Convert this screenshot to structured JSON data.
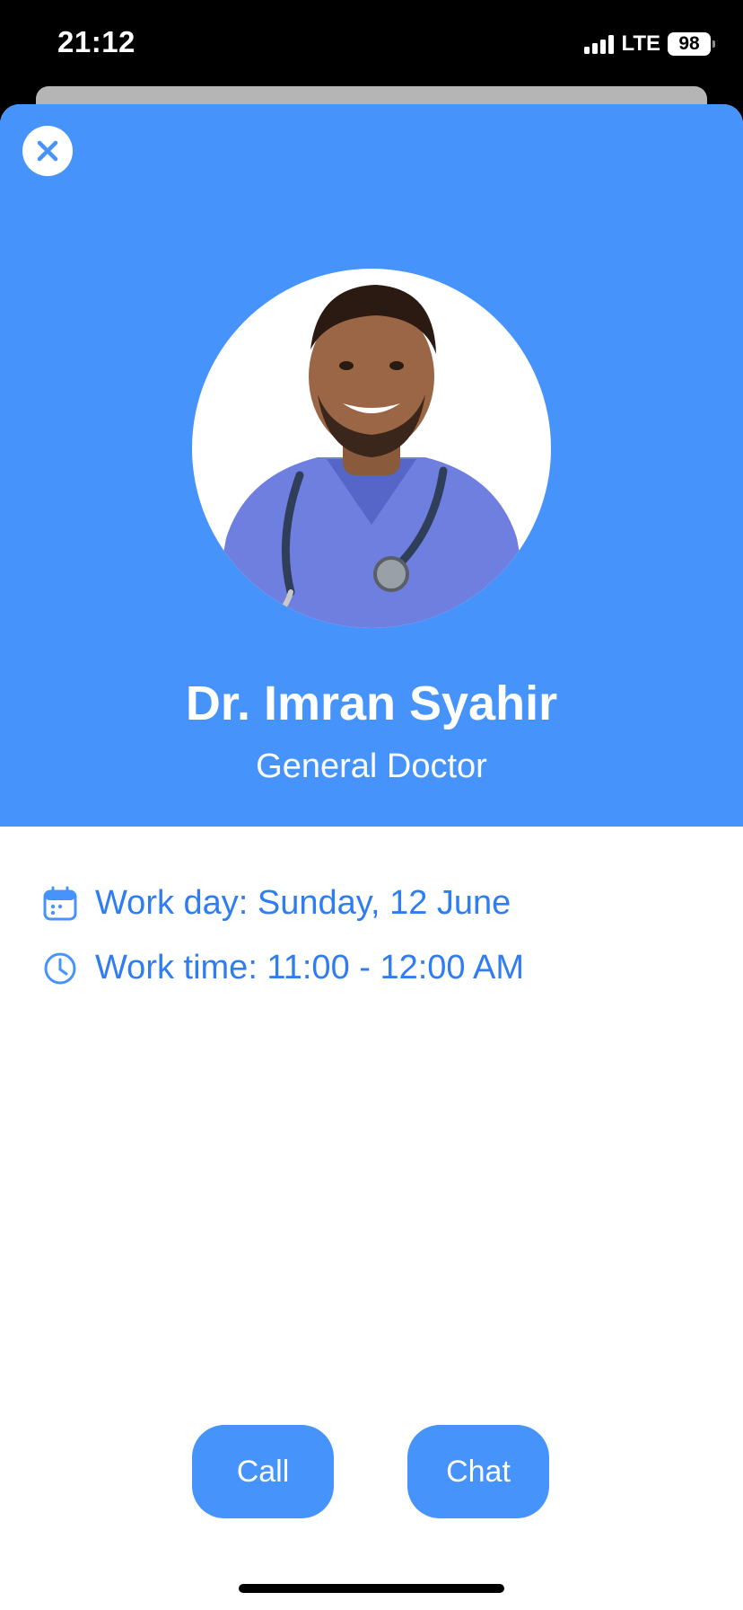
{
  "status_bar": {
    "time": "21:12",
    "network": "LTE",
    "battery": "98",
    "signal_bars": 4
  },
  "colors": {
    "accent": "#4694fb",
    "link_text": "#2f7df0"
  },
  "header": {
    "close_icon": "close-icon"
  },
  "doctor": {
    "name": "Dr. Imran Syahir",
    "role": "General Doctor",
    "avatar_icon": "doctor-photo"
  },
  "schedule": {
    "work_day": "Work day: Sunday, 12 June",
    "work_day_icon": "calendar-icon",
    "work_time": "Work time: 11:00 - 12:00 AM",
    "work_time_icon": "clock-icon"
  },
  "actions": {
    "call_label": "Call",
    "chat_label": "Chat"
  }
}
